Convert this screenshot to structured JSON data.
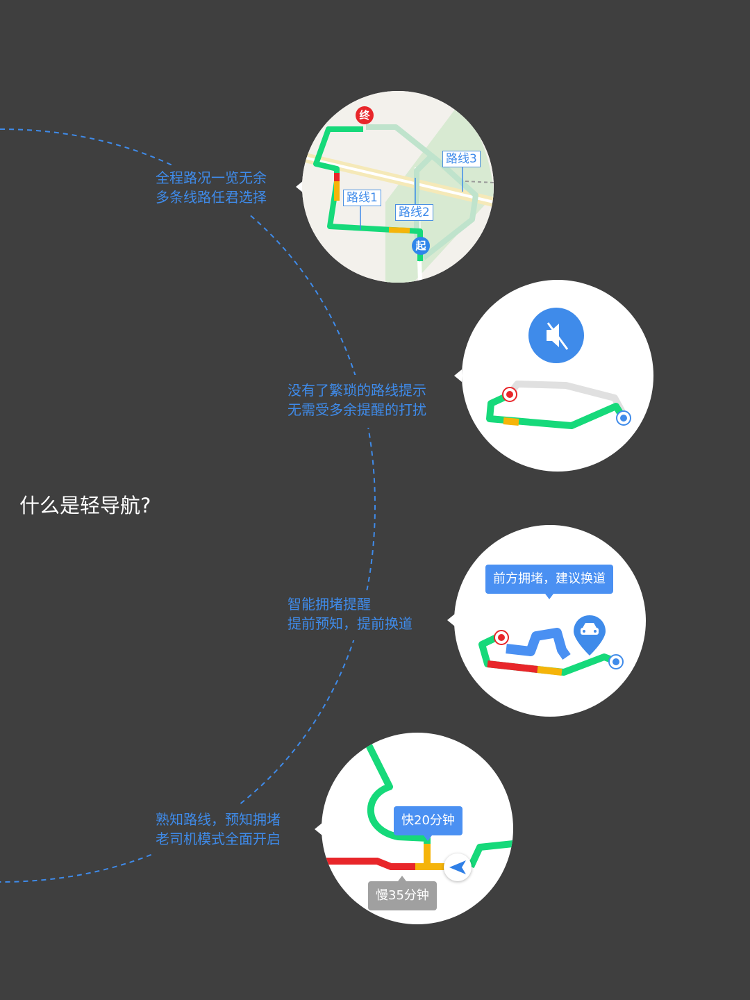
{
  "title": "什么是轻导航?",
  "features": [
    {
      "caption": [
        "全程路况一览无余",
        "多条线路任君选择"
      ],
      "route_labels": [
        "路线1",
        "路线2",
        "路线3"
      ],
      "end_pin": "终",
      "start_pin": "起"
    },
    {
      "caption": [
        "没有了繁琐的路线提示",
        "无需受多余提醒的打扰"
      ],
      "icon": "mute-speaker-icon"
    },
    {
      "caption": [
        "智能拥堵提醒",
        "提前预知，提前换道"
      ],
      "bubble": "前方拥堵，建议换道",
      "icon": "car-icon"
    },
    {
      "caption": [
        "熟知路线，预知拥堵",
        "老司机模式全面开启"
      ],
      "fast_label": "快20分钟",
      "slow_label": "慢35分钟",
      "icon": "navigation-arrow-icon"
    }
  ],
  "colors": {
    "background": "#3f3f3f",
    "accent": "#3f8bea",
    "route_green": "#16d97a",
    "route_yellow": "#f5b40a",
    "route_red": "#e8262a"
  }
}
